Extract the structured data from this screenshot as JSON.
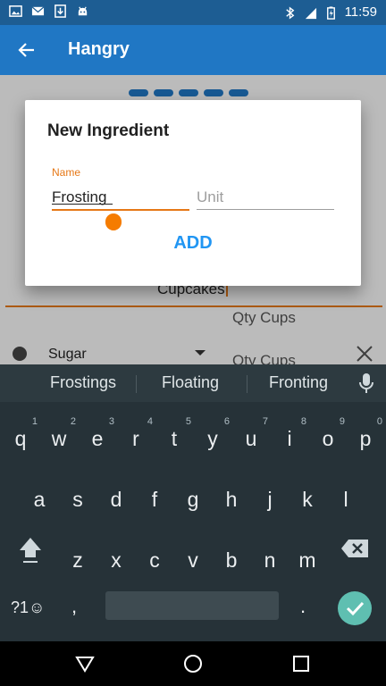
{
  "status_bar": {
    "time": "11:59",
    "icons_left": [
      "image-icon",
      "mail-icon",
      "download-icon",
      "android-icon"
    ],
    "icons_right": [
      "bluetooth-icon",
      "lte-signal-icon",
      "battery-icon"
    ]
  },
  "app_bar": {
    "title": "Hangry",
    "back_icon": "arrow-back-icon",
    "color": "#2077c4"
  },
  "background": {
    "recipe_name": "Cupcakes",
    "rows": [
      {
        "qty_label": "Qty Cups"
      },
      {
        "name": "Sugar",
        "qty_label": "Qty Cups"
      }
    ]
  },
  "dialog": {
    "title": "New Ingredient",
    "name_label": "Name",
    "name_value": "Frosting",
    "unit_placeholder": "Unit",
    "add_label": "ADD",
    "accent": "#e67817",
    "button_color": "#2196f3"
  },
  "keyboard": {
    "suggestions": [
      "Frostings",
      "Floating",
      "Fronting"
    ],
    "row1": [
      {
        "ch": "q",
        "hint": "1"
      },
      {
        "ch": "w",
        "hint": "2"
      },
      {
        "ch": "e",
        "hint": "3"
      },
      {
        "ch": "r",
        "hint": "4"
      },
      {
        "ch": "t",
        "hint": "5"
      },
      {
        "ch": "y",
        "hint": "6"
      },
      {
        "ch": "u",
        "hint": "7"
      },
      {
        "ch": "i",
        "hint": "8"
      },
      {
        "ch": "o",
        "hint": "9"
      },
      {
        "ch": "p",
        "hint": "0"
      }
    ],
    "row2": [
      "a",
      "s",
      "d",
      "f",
      "g",
      "h",
      "j",
      "k",
      "l"
    ],
    "row3": [
      "z",
      "x",
      "c",
      "v",
      "b",
      "n",
      "m"
    ],
    "symbols_label": "?1☺",
    "comma": ",",
    "period": "."
  },
  "nav_bar": {
    "icons": [
      "back-triangle-icon",
      "home-circle-icon",
      "recents-square-icon"
    ]
  }
}
